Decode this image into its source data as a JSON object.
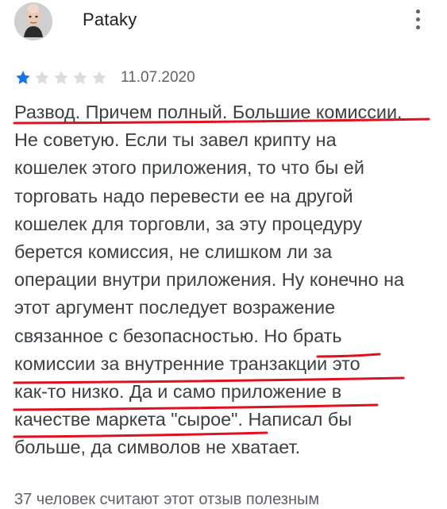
{
  "reviewer": {
    "name": "Pataky",
    "avatar_icon": "user-avatar-icon"
  },
  "menu": {
    "icon": "more-vert-icon"
  },
  "rating": {
    "value": 1,
    "max": 5,
    "filled_color": "#1a73e8",
    "empty_color": "#dadce0"
  },
  "review": {
    "date": "11.07.2020",
    "lines": [
      "Развод. Причем полный. Большие комиссии.",
      "Не советую. Если ты завел крипту на",
      "кошелек этого приложения, то что бы ей",
      "торговать надо перевести ее на другой",
      "кошелек для торговли, за эту процедуру",
      "берется комиссия, не слишком ли за",
      "операции внутри приложения. Ну конечно на",
      "этот аргумент последует возражение",
      "связанное с безопасностью. Но брать",
      "комиссии за внутренние транзакции это",
      "как-то низко. Да и само приложение в",
      "качестве маркета \"сырое\". Написал бы",
      "больше, да символов не хватает."
    ]
  },
  "helpful": {
    "text": "37 человек считают этот отзыв полезным"
  },
  "annotation": {
    "underline_color": "#e0101f"
  }
}
